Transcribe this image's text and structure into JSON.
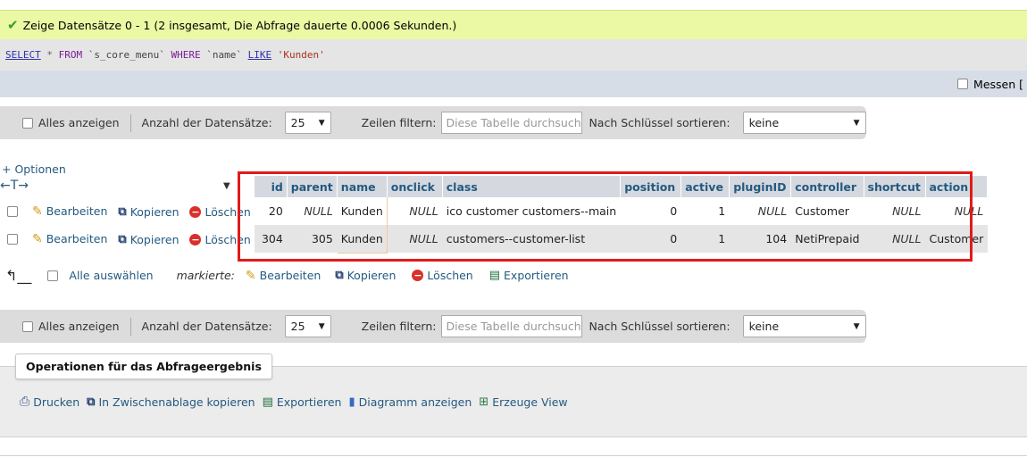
{
  "success": {
    "message": "Zeige Datensätze 0 - 1 (2 insgesamt, Die Abfrage dauerte 0.0006 Sekunden.)"
  },
  "sql": {
    "select": "SELECT",
    "star": "*",
    "from": "FROM",
    "table": "`s_core_menu`",
    "where": "WHERE",
    "column": "`name`",
    "like": "LIKE",
    "value": "'Kunden'"
  },
  "measure": {
    "label": "Messen ["
  },
  "nav": {
    "show_all": "Alles anzeigen",
    "rows_label": "Anzahl der Datensätze:",
    "rows_value": "25",
    "filter_label": "Zeilen filtern:",
    "filter_placeholder": "Diese Tabelle durchsuchen",
    "sort_label": "Nach Schlüssel sortieren:",
    "sort_value": "keine"
  },
  "options_link": "+ Optionen",
  "arrows": "←T→",
  "table": {
    "columns": [
      "id",
      "parent",
      "name",
      "onclick",
      "class",
      "position",
      "active",
      "pluginID",
      "controller",
      "shortcut",
      "action"
    ],
    "actions": {
      "edit": "Bearbeiten",
      "copy": "Kopieren",
      "delete": "Löschen"
    },
    "rows": [
      [
        "20",
        "NULL",
        "Kunden",
        "NULL",
        "ico customer customers--main",
        "0",
        "1",
        "NULL",
        "Customer",
        "NULL",
        "NULL"
      ],
      [
        "304",
        "305",
        "Kunden",
        "NULL",
        "customers--customer-list",
        "0",
        "1",
        "104",
        "NetiPrepaid",
        "NULL",
        "Customer"
      ]
    ]
  },
  "bulk": {
    "select_all": "Alle auswählen",
    "marked": "markierte:",
    "edit": "Bearbeiten",
    "copy": "Kopieren",
    "delete": "Löschen",
    "export": "Exportieren"
  },
  "operations": {
    "title": "Operationen für das Abfrageergebnis",
    "print": "Drucken",
    "clipboard": "In Zwischenablage kopieren",
    "export": "Exportieren",
    "chart": "Diagramm anzeigen",
    "view": "Erzeuge View"
  },
  "colors": {
    "success_bg": "#ebf8a4",
    "link": "#235a81",
    "highlight_box": "#e21a1a"
  }
}
